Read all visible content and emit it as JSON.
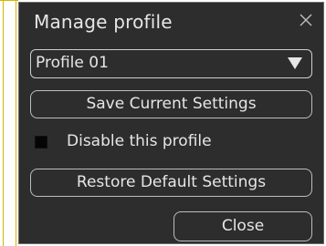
{
  "colors": {
    "dialog_background": "#2d2d2d",
    "text": "#e6e6e6",
    "border": "#bdbdbd"
  },
  "dialog": {
    "title": "Manage profile",
    "close_icon": "close-x-icon"
  },
  "profile_select": {
    "selected": "Profile 01",
    "arrow_icon": "triangle-down-icon"
  },
  "buttons": {
    "save_label": "Save Current Settings",
    "restore_label": "Restore Default Settings",
    "close_label": "Close"
  },
  "disable_profile": {
    "label": "Disable this profile",
    "checked": false
  }
}
